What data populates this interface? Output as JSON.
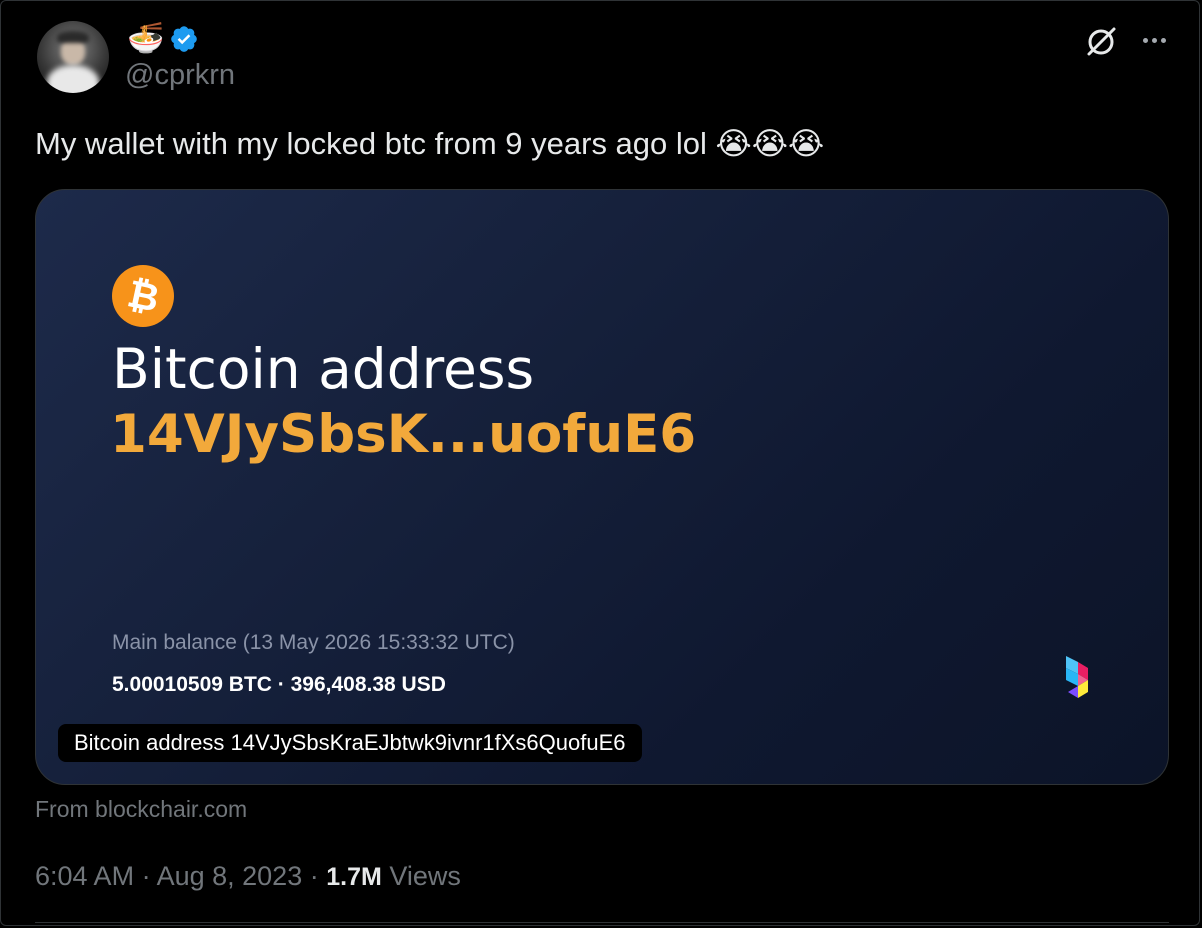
{
  "author": {
    "emoji": "🍜",
    "handle": "@cprkrn",
    "verified": true
  },
  "tweet": {
    "text": "My wallet with my locked btc from 9 years ago lol",
    "emojis": "😭😭😭"
  },
  "card": {
    "title": "Bitcoin address",
    "short_address": "14VJySbsK...uofuE6",
    "balance_label": "Main balance (13 May 2026 15:33:32 UTC)",
    "balance_value": "5.00010509 BTC · 396,408.38 USD",
    "alt_caption": "Bitcoin address 14VJySbsKraEJbtwk9ivnr1fXs6QuofuE6",
    "btc_symbol": "₿",
    "icons": [
      "bitcoin-logo-icon",
      "blockchair-logo-icon"
    ]
  },
  "source": "From blockchair.com",
  "meta": {
    "time": "6:04 AM",
    "separator": " · ",
    "date": "Aug 8, 2023",
    "views_count": "1.7M",
    "views_label": "Views"
  },
  "icons": {
    "grok": "grok-icon",
    "more": "more-icon",
    "verified": "verified-badge-icon"
  },
  "colors": {
    "background": "#000000",
    "card_accent": "#f2a93b",
    "bitcoin_orange": "#f7931a",
    "verified_blue": "#1d9bf0",
    "muted_text": "#71767b"
  }
}
